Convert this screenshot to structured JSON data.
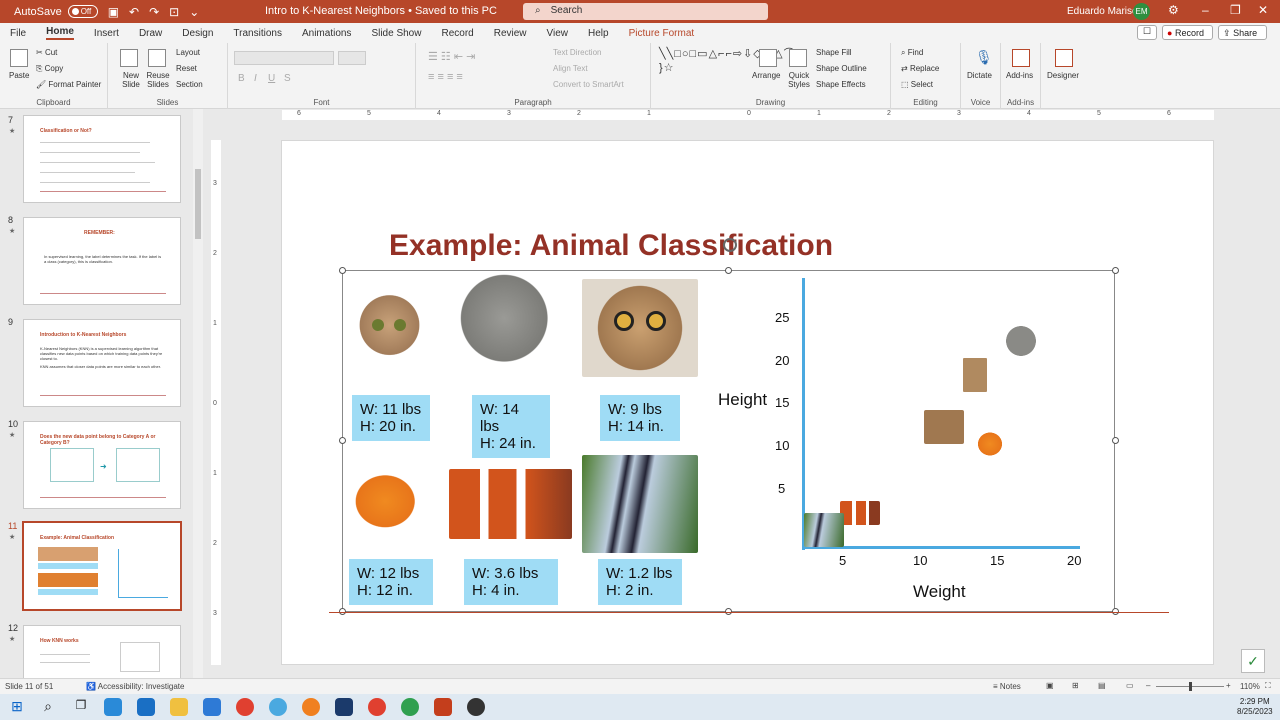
{
  "titlebar": {
    "autosave": "AutoSave",
    "toggle": "Off",
    "doc_title": "Intro to K-Nearest Neighbors  •  Saved to this PC",
    "search_placeholder": "Search",
    "user": "Eduardo Mariscal",
    "initials": "EM"
  },
  "menu": [
    "File",
    "Home",
    "Insert",
    "Draw",
    "Design",
    "Transitions",
    "Animations",
    "Slide Show",
    "Record",
    "Review",
    "View",
    "Help",
    "Picture Format"
  ],
  "buttons": {
    "record": "Record",
    "share": "Share"
  },
  "ribbon": {
    "clipboard": {
      "label": "Clipboard",
      "paste": "Paste",
      "cut": "Cut",
      "copy": "Copy",
      "format_painter": "Format Painter"
    },
    "slides": {
      "label": "Slides",
      "new_slide": "New Slide",
      "reuse": "Reuse Slides",
      "layout": "Layout",
      "reset": "Reset",
      "section": "Section"
    },
    "font": {
      "label": "Font"
    },
    "paragraph": {
      "label": "Paragraph",
      "text_direction": "Text Direction",
      "align_text": "Align Text",
      "smartart": "Convert to SmartArt"
    },
    "drawing": {
      "label": "Drawing",
      "arrange": "Arrange",
      "quick_styles": "Quick Styles",
      "shape_fill": "Shape Fill",
      "shape_outline": "Shape Outline",
      "shape_effects": "Shape Effects"
    },
    "editing": {
      "label": "Editing",
      "find": "Find",
      "replace": "Replace",
      "select": "Select"
    },
    "voice": {
      "label": "Voice",
      "dictate": "Dictate"
    },
    "addins": {
      "label": "Add-ins",
      "addins": "Add-ins"
    },
    "designer": {
      "designer": "Designer"
    }
  },
  "thumbnails": [
    {
      "num": "7",
      "title": "Classification or Not?"
    },
    {
      "num": "8",
      "title": "REMEMBER:",
      "text": "In supervised learning, the label determines the task. If the label is a class (category), this is classification."
    },
    {
      "num": "9",
      "title": "Introduction to K-Nearest Neighbors",
      "text": "K-Nearest Neighbors (KNN) is a supervised learning algorithm that classifies new data points based on which training data points they're closest to.",
      "text2": "KNN assumes that closer data points are more similar to each other."
    },
    {
      "num": "10",
      "title": "Does the new data point belong to Category A or Category B?"
    },
    {
      "num": "11",
      "title": "Example: Animal Classification"
    },
    {
      "num": "12",
      "title": "How KNN works"
    }
  ],
  "ruler": {
    "h": [
      "6",
      "5",
      "4",
      "3",
      "2",
      "1",
      "0",
      "1",
      "2",
      "3",
      "4",
      "5",
      "6"
    ],
    "v": [
      "3",
      "2",
      "1",
      "0",
      "1",
      "2",
      "3"
    ]
  },
  "slide": {
    "title": "Example: Animal Classification",
    "animals": [
      {
        "name": "cat-1",
        "w": "W: 11 lbs",
        "h": "H: 20 in."
      },
      {
        "name": "cat-2",
        "w": "W: 14 lbs",
        "h": "H: 24 in."
      },
      {
        "name": "cat-3",
        "w": "W: 9 lbs",
        "h": "H: 14 in."
      },
      {
        "name": "goldfish",
        "w": "W: 12 lbs",
        "h": "H:  12 in."
      },
      {
        "name": "clownfish",
        "w": "W: 3.6 lbs",
        "h": "H:  4 in."
      },
      {
        "name": "angelfish",
        "w": "W: 1.2 lbs",
        "h": "H:  2 in."
      }
    ],
    "chart_data": {
      "type": "scatter",
      "xlabel": "Weight",
      "ylabel": "Height",
      "xticks": [
        "5",
        "10",
        "15",
        "20"
      ],
      "yticks": [
        "25",
        "20",
        "15",
        "10",
        "5"
      ],
      "points": [
        {
          "x": 11,
          "y": 20
        },
        {
          "x": 14,
          "y": 24
        },
        {
          "x": 9,
          "y": 14
        },
        {
          "x": 12,
          "y": 12
        },
        {
          "x": 3.6,
          "y": 4
        },
        {
          "x": 1.2,
          "y": 2
        }
      ]
    }
  },
  "status": {
    "slide": "Slide 11 of 51",
    "accessibility": "Accessibility: Investigate",
    "notes": "Notes",
    "zoom": "110%"
  },
  "clock": {
    "time": "2:29 PM",
    "date": "8/25/2023"
  }
}
